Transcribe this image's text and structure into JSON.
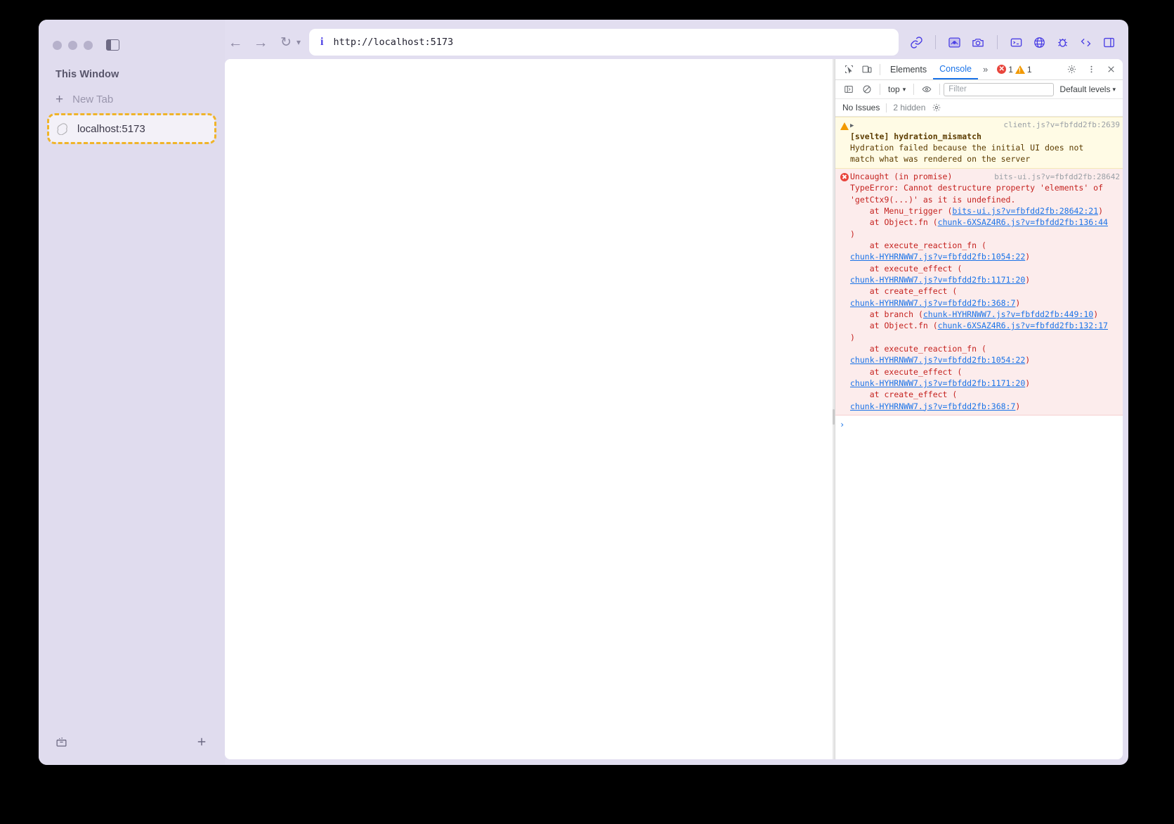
{
  "browser": {
    "sidebar": {
      "section_title": "This Window",
      "new_tab_label": "New Tab",
      "tabs": [
        {
          "title": "localhost:5173",
          "favicon": "svelte-icon",
          "active": true
        }
      ],
      "footer": {
        "left_icon": "archive-box-icon",
        "right_icon": "plus-icon"
      }
    },
    "toolbar": {
      "back_icon": "arrow-left-icon",
      "forward_icon": "arrow-right-icon",
      "reload_icon": "reload-icon",
      "reload_chevron": "chevron-down-icon",
      "url": "http://localhost:5173",
      "info_icon": "info-icon",
      "right_icons": [
        "link-icon",
        "extension-icon",
        "screenshot-camera-icon",
        "terminal-icon",
        "globe-icon",
        "bug-icon",
        "split-view-icon",
        "sidebar-right-icon"
      ]
    }
  },
  "devtools": {
    "tabs": [
      {
        "label": "Elements",
        "active": false
      },
      {
        "label": "Console",
        "active": true
      }
    ],
    "more_tabs_icon": "chevron-double-right-icon",
    "inspect_icon": "inspect-element-icon",
    "device_icon": "device-toolbar-icon",
    "error_count": "1",
    "warning_count": "1",
    "settings_icon": "gear-icon",
    "menu_icon": "kebab-menu-icon",
    "close_icon": "close-icon",
    "console_toolbar": {
      "sidebar_icon": "console-sidebar-icon",
      "clear_icon": "clear-console-icon",
      "context": "top",
      "context_chevron": "chevron-down-icon",
      "eye_icon": "live-expression-icon",
      "filter_placeholder": "Filter",
      "filter_value": "",
      "levels_label": "Default levels",
      "levels_chevron": "chevron-down-icon"
    },
    "issues_bar": {
      "issues_label": "No Issues",
      "hidden_label": "2 hidden",
      "settings_icon": "console-settings-icon"
    },
    "messages": [
      {
        "type": "warning",
        "icon": "warning-triangle-icon",
        "disclosure": "▶",
        "source": "client.js?v=fbfdd2fb:2639",
        "title": "[svelte] hydration_mismatch",
        "body": "Hydration failed because the initial UI does not\nmatch what was rendered on the server"
      },
      {
        "type": "error",
        "icon": "error-circle-icon",
        "header": "Uncaught (in promise)",
        "source": "bits-ui.js?v=fbfdd2fb:28642",
        "message": "TypeError: Cannot destructure property 'elements' of\n'getCtx9(...)' as it is undefined.",
        "stack": [
          {
            "fn": "    at Menu_trigger (",
            "link": "bits-ui.js?v=fbfdd2fb:28642:21",
            "tail": ")"
          },
          {
            "fn": "    at Object.fn (",
            "link": "chunk-6XSAZ4R6.js?v=fbfdd2fb:136:44",
            "tail": "\n)"
          },
          {
            "fn": "    at execute_reaction_fn (\n",
            "link": "chunk-HYHRNWW7.js?v=fbfdd2fb:1054:22",
            "tail": ")"
          },
          {
            "fn": "    at execute_effect (\n",
            "link": "chunk-HYHRNWW7.js?v=fbfdd2fb:1171:20",
            "tail": ")"
          },
          {
            "fn": "    at create_effect (\n",
            "link": "chunk-HYHRNWW7.js?v=fbfdd2fb:368:7",
            "tail": ")"
          },
          {
            "fn": "    at branch (",
            "link": "chunk-HYHRNWW7.js?v=fbfdd2fb:449:10",
            "tail": ")"
          },
          {
            "fn": "    at Object.fn (",
            "link": "chunk-6XSAZ4R6.js?v=fbfdd2fb:132:17",
            "tail": "\n)"
          },
          {
            "fn": "    at execute_reaction_fn (\n",
            "link": "chunk-HYHRNWW7.js?v=fbfdd2fb:1054:22",
            "tail": ")"
          },
          {
            "fn": "    at execute_effect (\n",
            "link": "chunk-HYHRNWW7.js?v=fbfdd2fb:1171:20",
            "tail": ")"
          },
          {
            "fn": "    at create_effect (\n",
            "link": "chunk-HYHRNWW7.js?v=fbfdd2fb:368:7",
            "tail": ")"
          }
        ]
      }
    ],
    "prompt_caret": "›"
  },
  "colors": {
    "sidebar_bg": "#e0dcee",
    "accent_blue": "#4b3fe4",
    "devtools_link": "#1a73e8",
    "error_red": "#e8453c",
    "warning_orange": "#f29900",
    "tab_highlight": "#f0b429"
  }
}
